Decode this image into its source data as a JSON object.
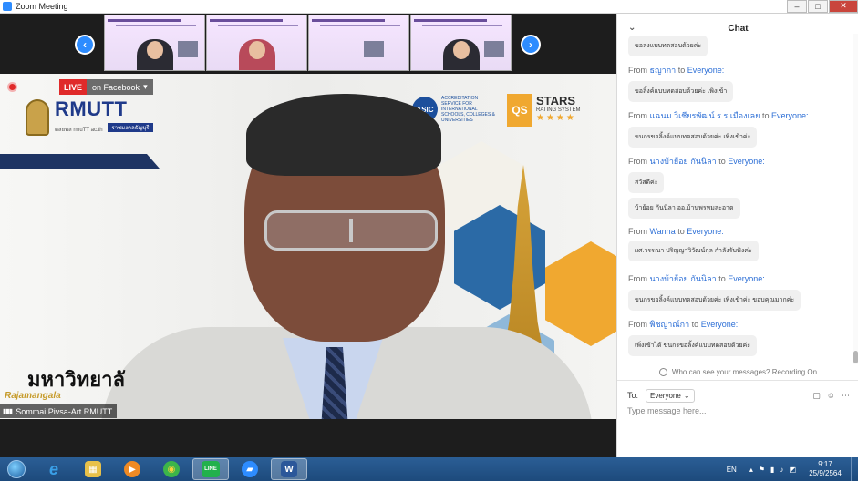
{
  "window": {
    "title": "Zoom Meeting",
    "minimize": "–",
    "maximize": "□",
    "close": "✕"
  },
  "gallery": {
    "prev_icon": "‹",
    "next_icon": "›"
  },
  "main_video": {
    "live_label": "LIVE",
    "facebook_label": "on Facebook",
    "facebook_caret": "▾",
    "rmutt_brand": "RMUTT",
    "rmutt_sub": "ดลยพล rmuTT ac.th",
    "rmutt_tag": "ราชมงคลธัญบุรี",
    "asic_mark": "ASIC",
    "asic_text": "ACCREDITATION SERVICE FOR INTERNATIONAL SCHOOLS, COLLEGES & UNIVERSITIES",
    "qs_label": "QS",
    "stars_title": "STARS",
    "stars_sub": "RATING SYSTEM",
    "stars_rating": "★★★★",
    "uni_thai": "มหาวิทยาลั",
    "uni_en": "Rajamangala",
    "participant_name": "Sommai Pivsa-Art RMUTT",
    "signal_icon": "▮▮▮"
  },
  "chat": {
    "header": "Chat",
    "collapse_icon": "⌄",
    "messages": [
      {
        "sender": "",
        "to": "",
        "text": "ขอลงแบบทดสอบด้วยค่ะ",
        "partial": true
      },
      {
        "sender": "ธญากา",
        "to": "Everyone:",
        "text": "ขอลิ้งค์แบบทดสอบด้วยค่ะ เพิ่งเข้า"
      },
      {
        "sender": "แฉนม วิเชียรพัฒน์ ร.ร.เมืองเลย",
        "to": "Everyone:",
        "text": "ขนกรขอลิ้งค์แบบทดสอบด้วยค่ะ เพิ่งเข้าค่ะ"
      },
      {
        "sender": "นางบ้าย้อย กันนิลา",
        "to": "Everyone:",
        "text": "สวัสดีค่ะ",
        "text2": "บ้าย้อย กันนิลา ออ.บ้านพรหมสะอาด"
      },
      {
        "sender": "Wanna",
        "to": "Everyone:",
        "text": "ผศ.วรรณา ปริญญาวิวัฒน์กุล กำลังรับฟังค่ะ"
      },
      {
        "sender": "นางบ้าย้อย กันนิลา",
        "to": "Everyone:",
        "text": "ขนกรขอลิ้งค์แบบทดสอบด้วยค่ะ เพิ่งเข้าค่ะ ขอบคุณมากค่ะ"
      },
      {
        "sender": "พิชญาณ์กา",
        "to": "Everyone:",
        "text": "เพิ่งเข้าได้ ขนกรขอลิ้งค์แบบทดสอบด้วยค่ะ"
      }
    ],
    "from_word": "From",
    "to_word": "to",
    "privacy_text": "Who can see your messages? Recording On",
    "to_label": "To:",
    "to_value": "Everyone",
    "to_caret": "⌄",
    "file_icon": "▢",
    "emoji_icon": "☺",
    "more_icon": "⋯",
    "input_placeholder": "Type message here..."
  },
  "taskbar": {
    "apps": [
      {
        "name": "ie",
        "glyph": "e",
        "color": "#3aa0e8"
      },
      {
        "name": "explorer",
        "glyph": "▦",
        "color": "#e8c14a"
      },
      {
        "name": "media",
        "glyph": "▶",
        "color": "#f08a24"
      },
      {
        "name": "chrome",
        "glyph": "◉",
        "color": "#3cb54a"
      },
      {
        "name": "line",
        "glyph": "LINE",
        "color": "#22b14c"
      },
      {
        "name": "zoom",
        "glyph": "▰",
        "color": "#2d8cff"
      },
      {
        "name": "word",
        "glyph": "W",
        "color": "#2b579a"
      }
    ],
    "lang": "EN",
    "time": "9:17",
    "date": "25/9/2564",
    "tray_up": "▴",
    "tray_flag": "⚑",
    "tray_signal": "▮",
    "tray_volume": "♪",
    "tray_extra": "◩"
  }
}
